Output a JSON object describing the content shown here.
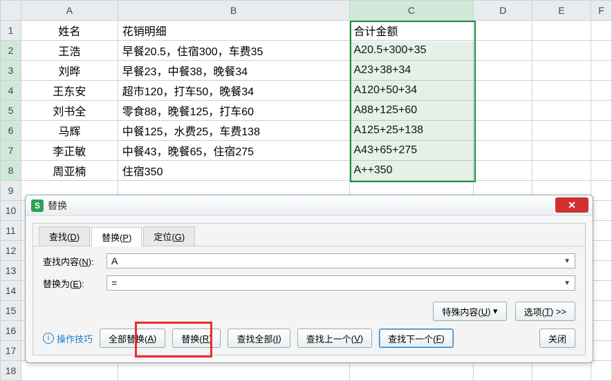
{
  "columns": [
    "A",
    "B",
    "C",
    "D",
    "E",
    "F"
  ],
  "row_count": 18,
  "header_row": {
    "A": "姓名",
    "B": "花销明细",
    "C": "合计金额"
  },
  "rows": [
    {
      "A": "王浩",
      "B": "早餐20.5，住宿300，车费35",
      "C": "A20.5+300+35"
    },
    {
      "A": "刘晔",
      "B": "早餐23，中餐38，晚餐34",
      "C": "A23+38+34"
    },
    {
      "A": "王东安",
      "B": "超市120，打车50，晚餐34",
      "C": "A120+50+34"
    },
    {
      "A": "刘书全",
      "B": "零食88，晚餐125，打车60",
      "C": "A88+125+60"
    },
    {
      "A": "马辉",
      "B": "中餐125，水费25，车费138",
      "C": "A125+25+138"
    },
    {
      "A": "李正敏",
      "B": "中餐43，晚餐65，住宿275",
      "C": "A43+65+275"
    },
    {
      "A": "周亚楠",
      "B": "住宿350",
      "C": "A++350"
    }
  ],
  "selection": {
    "range": "C2:C8",
    "active_col": "C"
  },
  "dialog": {
    "icon_letter": "S",
    "title": "替换",
    "tabs": {
      "find": {
        "label": "查找(",
        "key": "D",
        "suffix": ")"
      },
      "replace": {
        "label": "替换(",
        "key": "P",
        "suffix": ")"
      },
      "goto": {
        "label": "定位(",
        "key": "G",
        "suffix": ")"
      }
    },
    "active_tab": "replace",
    "find_label": "查找内容(",
    "find_key": "N",
    "find_suffix": "):",
    "find_value": "A",
    "replace_label": "替换为(",
    "replace_key": "E",
    "replace_suffix": "):",
    "replace_value": "=",
    "special_btn": {
      "pre": "特殊内容(",
      "key": "U",
      "suf": ")",
      "arrow": "▾"
    },
    "options_btn": {
      "pre": "选项(",
      "key": "T",
      "suf": ") >>"
    },
    "tip_label": "操作技巧",
    "buttons": {
      "replace_all": {
        "pre": "全部替换(",
        "key": "A",
        "suf": ")"
      },
      "replace_one": {
        "pre": "替换(",
        "key": "R",
        "suf": ")"
      },
      "find_all": {
        "pre": "查找全部(",
        "key": "I",
        "suf": ")"
      },
      "find_prev": {
        "pre": "查找上一个(",
        "key": "V",
        "suf": ")"
      },
      "find_next": {
        "pre": "查找下一个(",
        "key": "F",
        "suf": ")"
      },
      "close": "关闭"
    }
  },
  "chart_data": {
    "type": "table",
    "columns": [
      "姓名",
      "花销明细",
      "合计金额"
    ],
    "rows": [
      [
        "王浩",
        "早餐20.5，住宿300，车费35",
        "A20.5+300+35"
      ],
      [
        "刘晔",
        "早餐23，中餐38，晚餐34",
        "A23+38+34"
      ],
      [
        "王东安",
        "超市120，打车50，晚餐34",
        "A120+50+34"
      ],
      [
        "刘书全",
        "零食88，晚餐125，打车60",
        "A88+125+60"
      ],
      [
        "马辉",
        "中餐125，水费25，车费138",
        "A125+25+138"
      ],
      [
        "李正敏",
        "中餐43，晚餐65，住宿275",
        "A43+65+275"
      ],
      [
        "周亚楠",
        "住宿350",
        "A++350"
      ]
    ]
  }
}
